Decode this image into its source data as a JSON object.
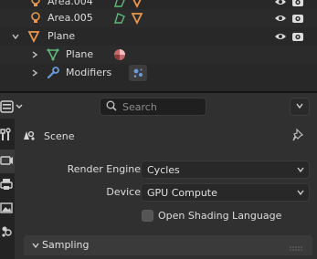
{
  "outliner": {
    "rows": [
      {
        "label": "Area.004",
        "kind": "light"
      },
      {
        "label": "Area.005",
        "kind": "light"
      },
      {
        "label": "Plane",
        "kind": "mesh-object"
      },
      {
        "label": "Plane",
        "kind": "mesh-data"
      },
      {
        "label": "Modifiers",
        "kind": "modifiers"
      }
    ]
  },
  "properties": {
    "search": {
      "placeholder": "Search"
    },
    "context": {
      "label": "Scene"
    },
    "render_engine": {
      "label": "Render Engine",
      "value": "Cycles"
    },
    "device": {
      "label": "Device",
      "value": "GPU Compute"
    },
    "osl": {
      "label": "Open Shading Language",
      "checked": false
    },
    "panel": {
      "title": "Sampling",
      "expanded": true
    }
  },
  "colors": {
    "object_orange": "#e8974c",
    "mesh_green": "#5fb87a",
    "wrench_blue": "#6b9bd8",
    "background": "#303030"
  }
}
